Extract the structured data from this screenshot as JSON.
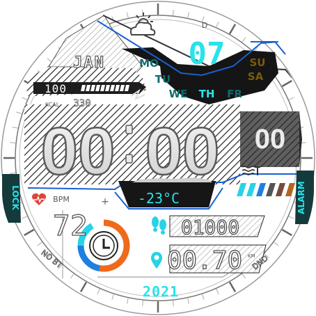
{
  "watch": {
    "month": "JAN",
    "weekday_letter": "D",
    "day": "07",
    "weekdays": [
      {
        "label": "MO",
        "color": "#0f6a6e"
      },
      {
        "label": "TU",
        "color": "#0f6a6e"
      },
      {
        "label": "WE",
        "color": "#0f6a6e"
      },
      {
        "label": "TH",
        "color": "#27e3ea"
      },
      {
        "label": "FR",
        "color": "#0f6a6e"
      },
      {
        "label": "SA",
        "color": "#7a5a0c"
      },
      {
        "label": "SU",
        "color": "#7a5a0c"
      }
    ],
    "battery_value": "100",
    "kcal_label": "KCAL",
    "kcal_value": "330",
    "hours": "00",
    "minutes": "00",
    "seconds": "00",
    "temperature": "-23°C",
    "lock_label": "LOCK",
    "alarm_label": "ALARM",
    "bpm_label": "BPM",
    "bpm_value": "72",
    "steps_value": "01000",
    "distance_value": "00.70",
    "distance_unit": "KM",
    "year": "2021",
    "no_bt_label": "NO BT",
    "dnd_label": "DND",
    "accent_color": "#27e3ea",
    "heart_color": "#e0443a"
  }
}
